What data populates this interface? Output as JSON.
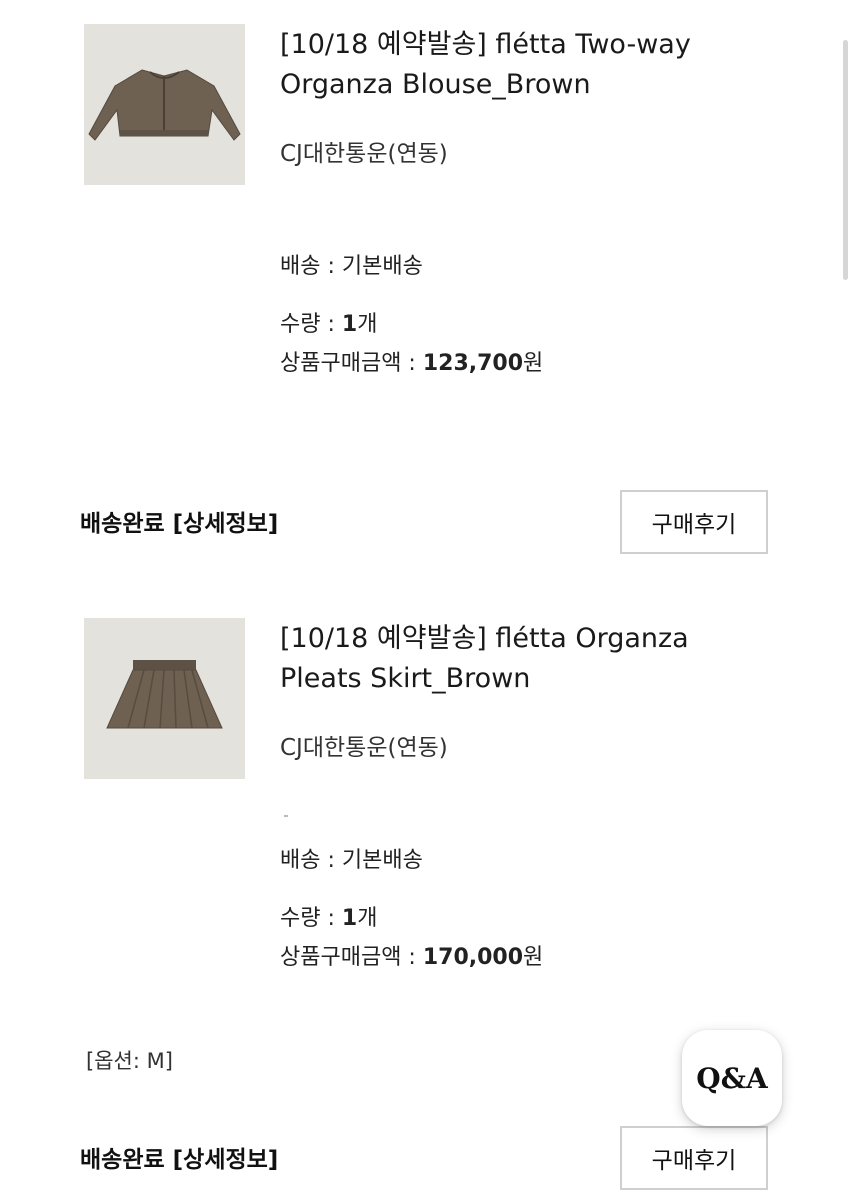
{
  "items": [
    {
      "title_line1": "[10/18 예약발송] flétta Two-way",
      "title_line2": "Organza Blouse_Brown",
      "carrier": "CJ대한통운(연동)",
      "shipping_label": "배송 : ",
      "shipping_value": "기본배송",
      "qty_label": "수량 : ",
      "qty_value": "1",
      "qty_unit": "개",
      "price_label": "상품구매금액 : ",
      "price_value": "123,700",
      "price_unit": "원",
      "status": "배송완료",
      "details_link": "[상세정보]",
      "review_button": "구매후기",
      "thumbnail_icon": "blouse-product-image"
    },
    {
      "title_line1": "[10/18 예약발송] flétta Organza",
      "title_line2": "Pleats Skirt_Brown",
      "carrier": "CJ대한통운(연동)",
      "shipping_label": "배송 : ",
      "shipping_value": "기본배송",
      "qty_label": "수량 : ",
      "qty_value": "1",
      "qty_unit": "개",
      "price_label": "상품구매금액 : ",
      "price_value": "170,000",
      "price_unit": "원",
      "option": "[옵션: M]",
      "status": "배송완료",
      "details_link": "[상세정보]",
      "review_button": "구매후기",
      "thumbnail_icon": "skirt-product-image"
    }
  ],
  "qa_button": "Q&A",
  "colors": {
    "thumb_bg": "#e4e2dd",
    "product_brown": "#6e6152",
    "button_border": "#cfcfcf"
  }
}
